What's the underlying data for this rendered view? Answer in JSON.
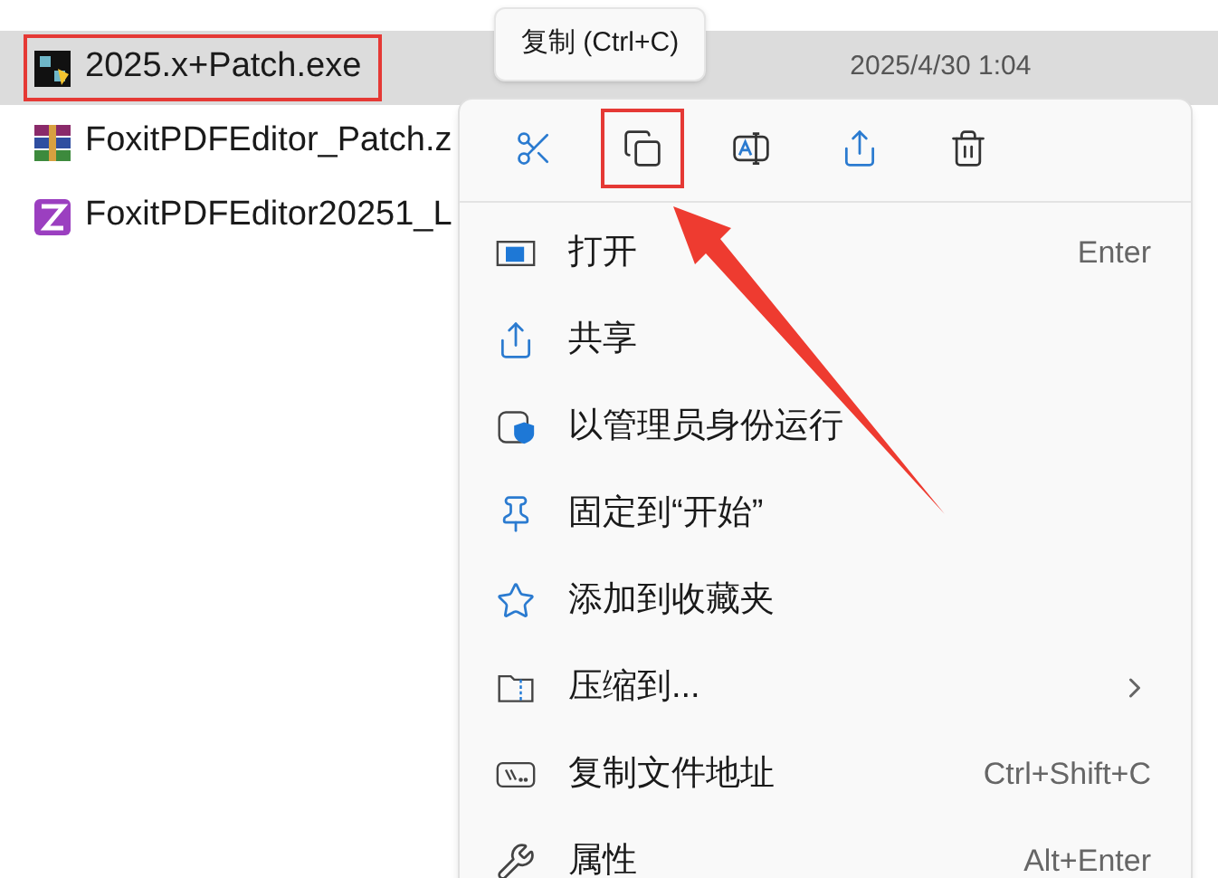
{
  "files": [
    {
      "name": "2025.x+Patch.exe",
      "date": "2025/4/30 1:04",
      "kind": "exe",
      "selected": true,
      "highlighted": true
    },
    {
      "name": "FoxitPDFEditor_Patch.z",
      "kind": "archive",
      "selected": false,
      "highlighted": false
    },
    {
      "name": "FoxitPDFEditor20251_L",
      "kind": "app",
      "selected": false,
      "highlighted": false
    }
  ],
  "tooltip": "复制 (Ctrl+C)",
  "context_menu": {
    "toolbar": [
      {
        "kind": "cut",
        "highlighted": false
      },
      {
        "kind": "copy",
        "highlighted": true
      },
      {
        "kind": "rename",
        "highlighted": false
      },
      {
        "kind": "share",
        "highlighted": false
      },
      {
        "kind": "delete",
        "highlighted": false
      }
    ],
    "items": [
      {
        "kind": "open",
        "label": "打开",
        "shortcut": "Enter",
        "submenu": false
      },
      {
        "kind": "share",
        "label": "共享",
        "submenu": false
      },
      {
        "kind": "admin",
        "label": "以管理员身份运行",
        "submenu": false
      },
      {
        "kind": "pin",
        "label": "固定到“开始”",
        "submenu": false
      },
      {
        "kind": "favorite",
        "label": "添加到收藏夹",
        "submenu": false
      },
      {
        "kind": "compress",
        "label": "压缩到...",
        "submenu": true
      },
      {
        "kind": "copypath",
        "label": "复制文件地址",
        "shortcut": "Ctrl+Shift+C",
        "submenu": false
      },
      {
        "kind": "properties",
        "label": "属性",
        "shortcut": "Alt+Enter",
        "submenu": false
      }
    ]
  }
}
